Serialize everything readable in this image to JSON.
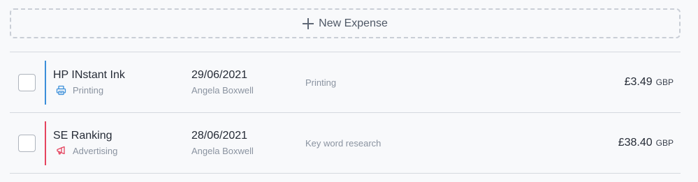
{
  "new_expense": {
    "label": "New Expense",
    "icon": "plus-icon"
  },
  "expenses": [
    {
      "merchant": "HP INstant Ink",
      "category": "Printing",
      "category_icon": "printer-icon",
      "accent_color": "#3b8fd9",
      "icon_color": "#3b8fd9",
      "date": "29/06/2021",
      "person": "Angela Boxwell",
      "description": "Printing",
      "amount": "£3.49",
      "currency": "GBP"
    },
    {
      "merchant": "SE Ranking",
      "category": "Advertising",
      "category_icon": "megaphone-icon",
      "accent_color": "#e5445f",
      "icon_color": "#e5445f",
      "date": "28/06/2021",
      "person": "Angela Boxwell",
      "description": "Key word research",
      "amount": "£38.40",
      "currency": "GBP"
    }
  ]
}
